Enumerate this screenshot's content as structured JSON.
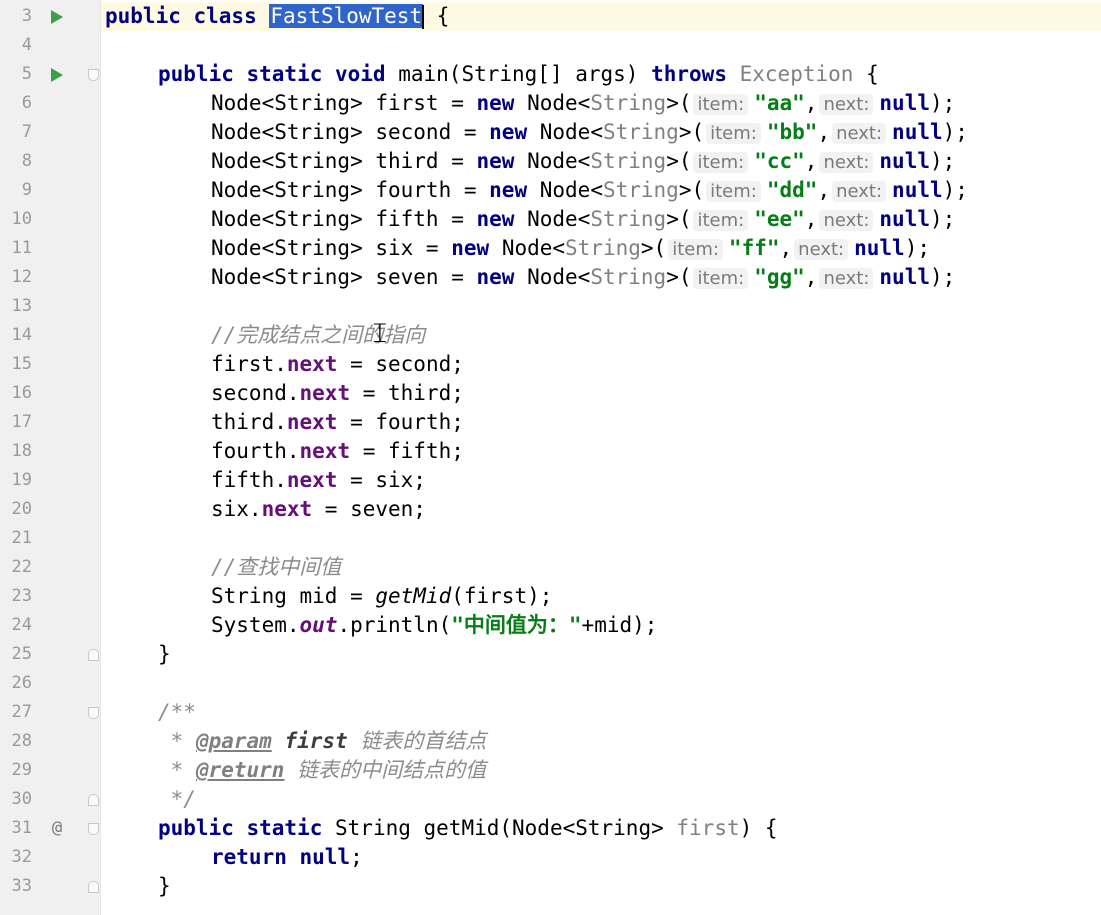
{
  "line_numbers": [
    "3",
    "4",
    "5",
    "6",
    "7",
    "8",
    "9",
    "10",
    "11",
    "12",
    "13",
    "14",
    "15",
    "16",
    "17",
    "18",
    "19",
    "20",
    "21",
    "22",
    "23",
    "24",
    "25",
    "26",
    "27",
    "28",
    "29",
    "30",
    "31",
    "32",
    "33"
  ],
  "gutter_markers": {
    "run": "▶",
    "override": "@"
  },
  "code": {
    "l3": {
      "kw1": "public class",
      "classname": "FastSlowTest",
      "brace": "{"
    },
    "l5": {
      "kw1": "public static void",
      "sig": "main(String[] args)",
      "throws": "throws",
      "exc": "Exception",
      "brace": "{"
    },
    "node_decls": [
      {
        "decl": "Node<String> first = ",
        "new": "new",
        "type": "Node<",
        "tparam": "String",
        "open": ">(",
        "hint_item": "item:",
        "value": "\"aa\"",
        "comma": ",",
        "hint_next": "next:",
        "nullkw": "null",
        "end": ");"
      },
      {
        "decl": "Node<String> second = ",
        "new": "new",
        "type": "Node<",
        "tparam": "String",
        "open": ">(",
        "hint_item": "item:",
        "value": "\"bb\"",
        "comma": ",",
        "hint_next": "next:",
        "nullkw": "null",
        "end": ");"
      },
      {
        "decl": "Node<String> third = ",
        "new": "new",
        "type": "Node<",
        "tparam": "String",
        "open": ">(",
        "hint_item": "item:",
        "value": "\"cc\"",
        "comma": ",",
        "hint_next": "next:",
        "nullkw": "null",
        "end": ");"
      },
      {
        "decl": "Node<String> fourth = ",
        "new": "new",
        "type": "Node<",
        "tparam": "String",
        "open": ">(",
        "hint_item": "item:",
        "value": "\"dd\"",
        "comma": ",",
        "hint_next": "next:",
        "nullkw": "null",
        "end": ");"
      },
      {
        "decl": "Node<String> fifth = ",
        "new": "new",
        "type": "Node<",
        "tparam": "String",
        "open": ">(",
        "hint_item": "item:",
        "value": "\"ee\"",
        "comma": ",",
        "hint_next": "next:",
        "nullkw": "null",
        "end": ");"
      },
      {
        "decl": "Node<String> six = ",
        "new": "new",
        "type": "Node<",
        "tparam": "String",
        "open": ">(",
        "hint_item": "item:",
        "value": "\"ff\"",
        "comma": ",",
        "hint_next": "next:",
        "nullkw": "null",
        "end": ");"
      },
      {
        "decl": "Node<String> seven = ",
        "new": "new",
        "type": "Node<",
        "tparam": "String",
        "open": ">(",
        "hint_item": "item:",
        "value": "\"gg\"",
        "comma": ",",
        "hint_next": "next:",
        "nullkw": "null",
        "end": ");"
      }
    ],
    "l14": "//完成结点之间的指向",
    "links": [
      {
        "lhs": "first.",
        "field": "next",
        "rhs": " = second;"
      },
      {
        "lhs": "second.",
        "field": "next",
        "rhs": " = third;"
      },
      {
        "lhs": "third.",
        "field": "next",
        "rhs": " = fourth;"
      },
      {
        "lhs": "fourth.",
        "field": "next",
        "rhs": " = fifth;"
      },
      {
        "lhs": "fifth.",
        "field": "next",
        "rhs": " = six;"
      },
      {
        "lhs": "six.",
        "field": "next",
        "rhs": " = seven;"
      }
    ],
    "l22": "//查找中间值",
    "l23": {
      "pre": "String mid = ",
      "call": "getMid",
      "post": "(first);"
    },
    "l24": {
      "pre": "System.",
      "out": "out",
      "mid": ".println(",
      "str": "\"中间值为：\"",
      "post": "+mid);"
    },
    "l25": "}",
    "l27": "/**",
    "l28": {
      "star": " * ",
      "tag": "@param",
      "param": "first",
      "desc": "链表的首结点"
    },
    "l29": {
      "star": " * ",
      "tag": "@return",
      "desc": "链表的中间结点的值"
    },
    "l30": " */",
    "l31": {
      "kw1": "public static",
      "rest": " String getMid(Node<String> ",
      "param": "first",
      "tail": ") {"
    },
    "l32": {
      "kw": "return null",
      "semi": ";"
    },
    "l33": "}"
  }
}
